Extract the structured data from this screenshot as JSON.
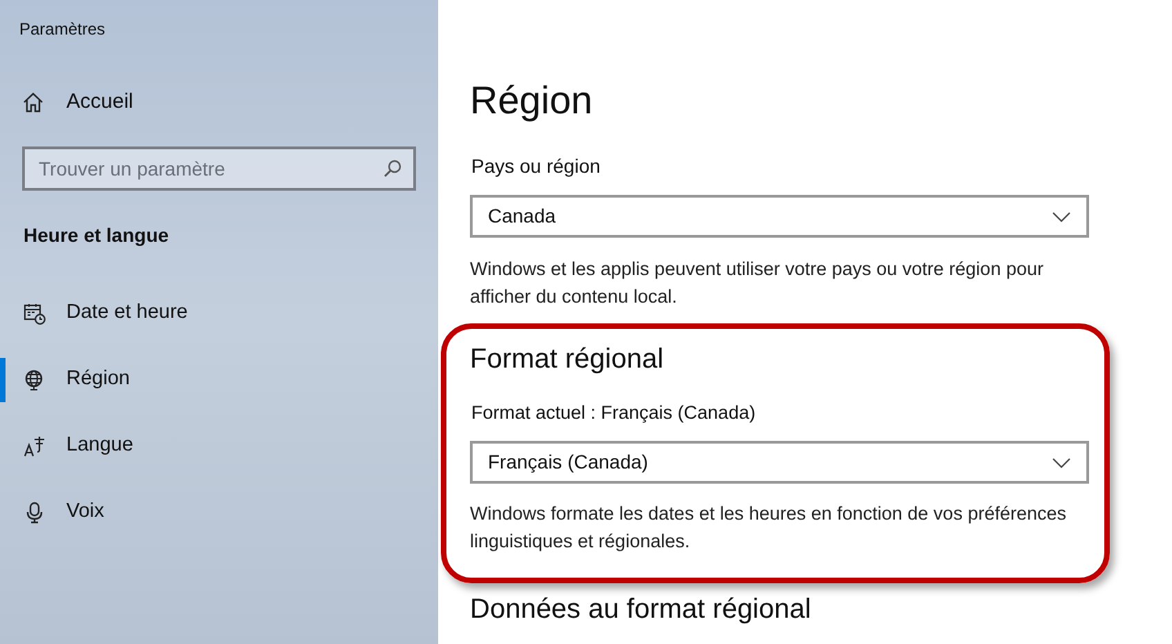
{
  "window": {
    "title": "Paramètres"
  },
  "sidebar": {
    "home": {
      "label": "Accueil",
      "kind": "home"
    },
    "search": {
      "placeholder": "Trouver un paramètre"
    },
    "section": "Heure et langue",
    "items": [
      {
        "label": "Date et heure",
        "kind": "calendar",
        "selected": false
      },
      {
        "label": "Région",
        "kind": "globe",
        "selected": true
      },
      {
        "label": "Langue",
        "kind": "language",
        "selected": false
      },
      {
        "label": "Voix",
        "kind": "microphone",
        "selected": false
      }
    ]
  },
  "page": {
    "title": "Région",
    "country": {
      "label": "Pays ou région",
      "value": "Canada",
      "description": "Windows et les applis peuvent utiliser votre pays ou votre région pour afficher du contenu local."
    },
    "format": {
      "heading": "Format régional",
      "label": "Format actuel : Français (Canada)",
      "value": "Français (Canada)",
      "description": "Windows formate les dates et les heures en fonction de vos préférences linguistiques et régionales.",
      "highlighted": true
    },
    "next_heading": "Données au format régional"
  }
}
